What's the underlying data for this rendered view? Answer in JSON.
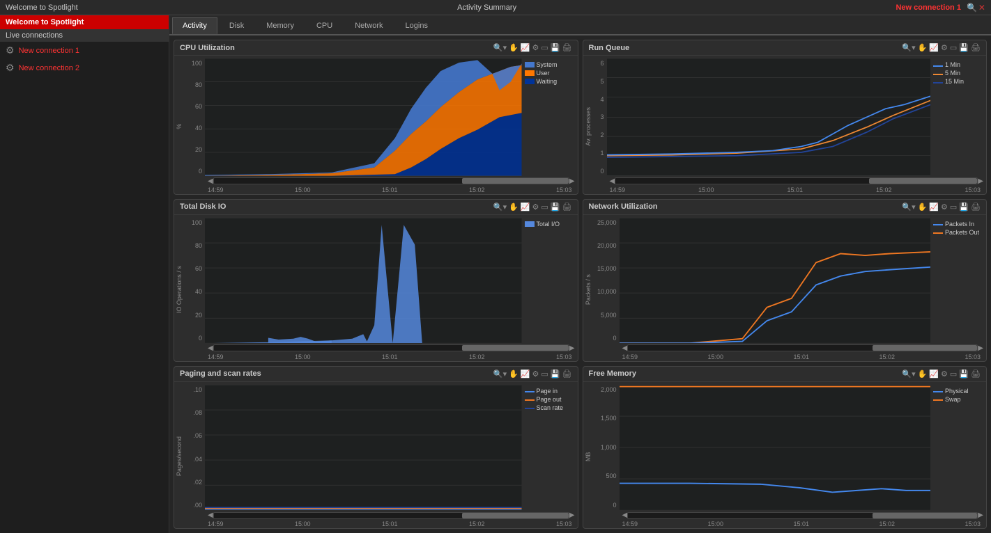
{
  "titleBar": {
    "appTitle": "Welcome to Spotlight",
    "sectionTitle": "Activity Summary",
    "newConnection": "New connection 1",
    "closeBtn": "✕",
    "minBtn": "−",
    "maxBtn": "□"
  },
  "sidebar": {
    "title": "Welcome to Spotlight",
    "sectionLabel": "Live connections",
    "items": [
      {
        "label": "New connection 1",
        "icon": "🖥"
      },
      {
        "label": "New connection 2",
        "icon": "🖥"
      }
    ]
  },
  "tabs": [
    {
      "label": "Activity",
      "active": true
    },
    {
      "label": "Disk",
      "active": false
    },
    {
      "label": "Memory",
      "active": false
    },
    {
      "label": "CPU",
      "active": false
    },
    {
      "label": "Network",
      "active": false
    },
    {
      "label": "Logins",
      "active": false
    }
  ],
  "charts": {
    "cpuUtilization": {
      "title": "CPU Utilization",
      "yLabel": "%",
      "yTicks": [
        "100",
        "80",
        "60",
        "40",
        "20",
        "0"
      ],
      "xTicks": [
        "14:59",
        "15:00",
        "15:01",
        "15:02",
        "15:03"
      ],
      "legend": [
        {
          "label": "System",
          "color": "#4477cc"
        },
        {
          "label": "User",
          "color": "#ff7700"
        },
        {
          "label": "Waiting",
          "color": "#003399"
        }
      ]
    },
    "runQueue": {
      "title": "Run Queue",
      "yLabel": "Av. processes",
      "yTicks": [
        "6",
        "5",
        "4",
        "3",
        "2",
        "1",
        "0"
      ],
      "xTicks": [
        "14:59",
        "15:00",
        "15:01",
        "15:02",
        "15:03"
      ],
      "legend": [
        {
          "label": "1 Min",
          "color": "#4488ee"
        },
        {
          "label": "5 Min",
          "color": "#ee8833"
        },
        {
          "label": "15 Min",
          "color": "#224499"
        }
      ]
    },
    "totalDiskIO": {
      "title": "Total Disk IO",
      "yLabel": "IO Operations / s",
      "yTicks": [
        "100",
        "80",
        "60",
        "40",
        "20",
        "0"
      ],
      "xTicks": [
        "14:59",
        "15:00",
        "15:01",
        "15:02",
        "15:03"
      ],
      "legend": [
        {
          "label": "Total I/O",
          "color": "#5588dd"
        }
      ]
    },
    "networkUtilization": {
      "title": "Network Utilization",
      "yLabel": "Packets / s",
      "yTicks": [
        "25,000",
        "20,000",
        "15,000",
        "10,000",
        "5,000",
        "0"
      ],
      "xTicks": [
        "14:59",
        "15:00",
        "15:01",
        "15:02",
        "15:03"
      ],
      "legend": [
        {
          "label": "Packets In",
          "color": "#4488ee"
        },
        {
          "label": "Packets Out",
          "color": "#ee7722"
        }
      ]
    },
    "pagingRates": {
      "title": "Paging and scan rates",
      "yLabel": "Pages/second",
      "yTicks": [
        ".10",
        ".08",
        ".06",
        ".04",
        ".02",
        ".00"
      ],
      "xTicks": [
        "14:59",
        "15:00",
        "15:01",
        "15:02",
        "15:03"
      ],
      "legend": [
        {
          "label": "Page in",
          "color": "#4488ee"
        },
        {
          "label": "Page out",
          "color": "#ee7722"
        },
        {
          "label": "Scan rate",
          "color": "#224499"
        }
      ]
    },
    "freeMemory": {
      "title": "Free Memory",
      "yLabel": "MB",
      "yTicks": [
        "2,000",
        "1,500",
        "1,000",
        "500",
        "0"
      ],
      "xTicks": [
        "14:59",
        "15:00",
        "15:01",
        "15:02",
        "15:03"
      ],
      "legend": [
        {
          "label": "Physical",
          "color": "#4488ee"
        },
        {
          "label": "Swap",
          "color": "#ee7722"
        }
      ]
    }
  },
  "colors": {
    "accent": "#cc0000",
    "green": "#00cc00",
    "chartBg": "#1e2a1e",
    "gridLine": "#3a3a3a"
  }
}
